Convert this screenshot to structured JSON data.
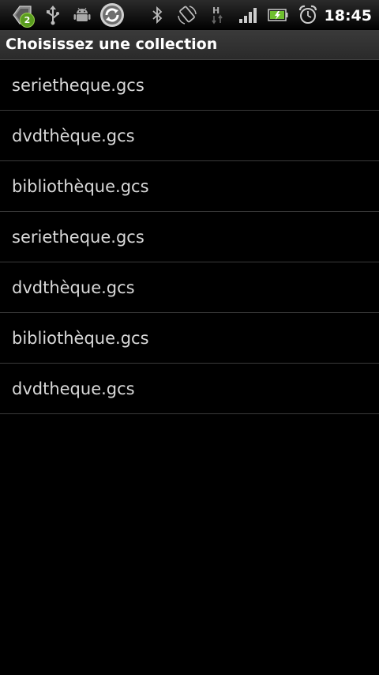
{
  "status_bar": {
    "notification_count": "2",
    "icons": [
      "notifications-icon",
      "usb-icon",
      "android-debug-icon",
      "sync-icon",
      "bluetooth-icon",
      "rotation-icon",
      "hspa-data-icon",
      "signal-icon",
      "battery-icon",
      "alarm-icon"
    ],
    "time": "18:45"
  },
  "title_bar": {
    "title": "Choisissez une collection"
  },
  "collections": [
    {
      "label": "serietheque.gcs"
    },
    {
      "label": "dvdthèque.gcs"
    },
    {
      "label": "bibliothèque.gcs"
    },
    {
      "label": "serietheque.gcs"
    },
    {
      "label": "dvdthèque.gcs"
    },
    {
      "label": "bibliothèque.gcs"
    },
    {
      "label": "dvdtheque.gcs"
    }
  ],
  "colors": {
    "background": "#000000",
    "title_bar": "#333333",
    "item_text": "#d9d9d9",
    "divider": "#3a3a3a",
    "badge": "#5a9d1f"
  }
}
